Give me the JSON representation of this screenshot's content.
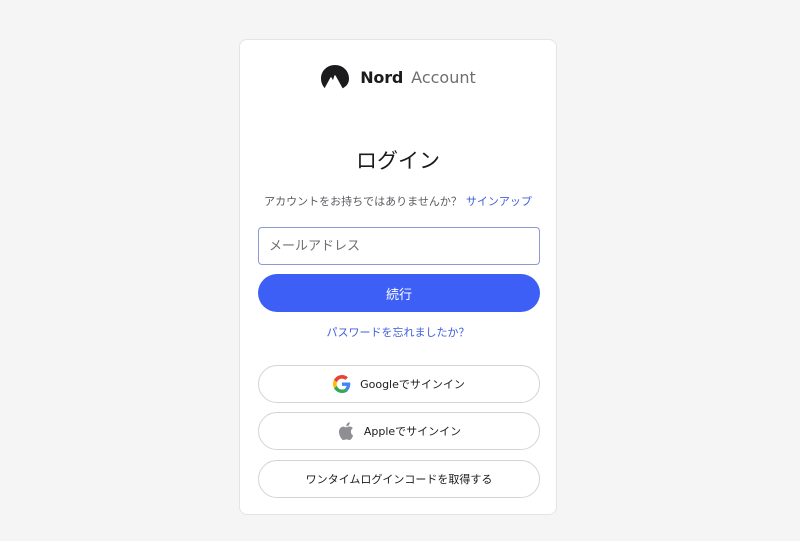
{
  "brand": {
    "name": "Nord",
    "sub": "Account"
  },
  "login": {
    "title": "ログイン",
    "no_account_text": "アカウントをお持ちではありませんか？",
    "signup_link": "サインアップ",
    "email_placeholder": "メールアドレス",
    "email_value": "",
    "continue_label": "続行",
    "forgot_link": "パスワードを忘れましたか？"
  },
  "sso": {
    "google_label": "Googleでサインイン",
    "google_icon": "google-icon",
    "apple_label": "Appleでサインイン",
    "apple_icon": "apple-icon",
    "otp_label": "ワンタイムログインコードを取得する"
  },
  "colors": {
    "primary": "#3e5ff5",
    "link": "#3e5fd9",
    "background": "#f5f5f5",
    "card": "#ffffff"
  }
}
